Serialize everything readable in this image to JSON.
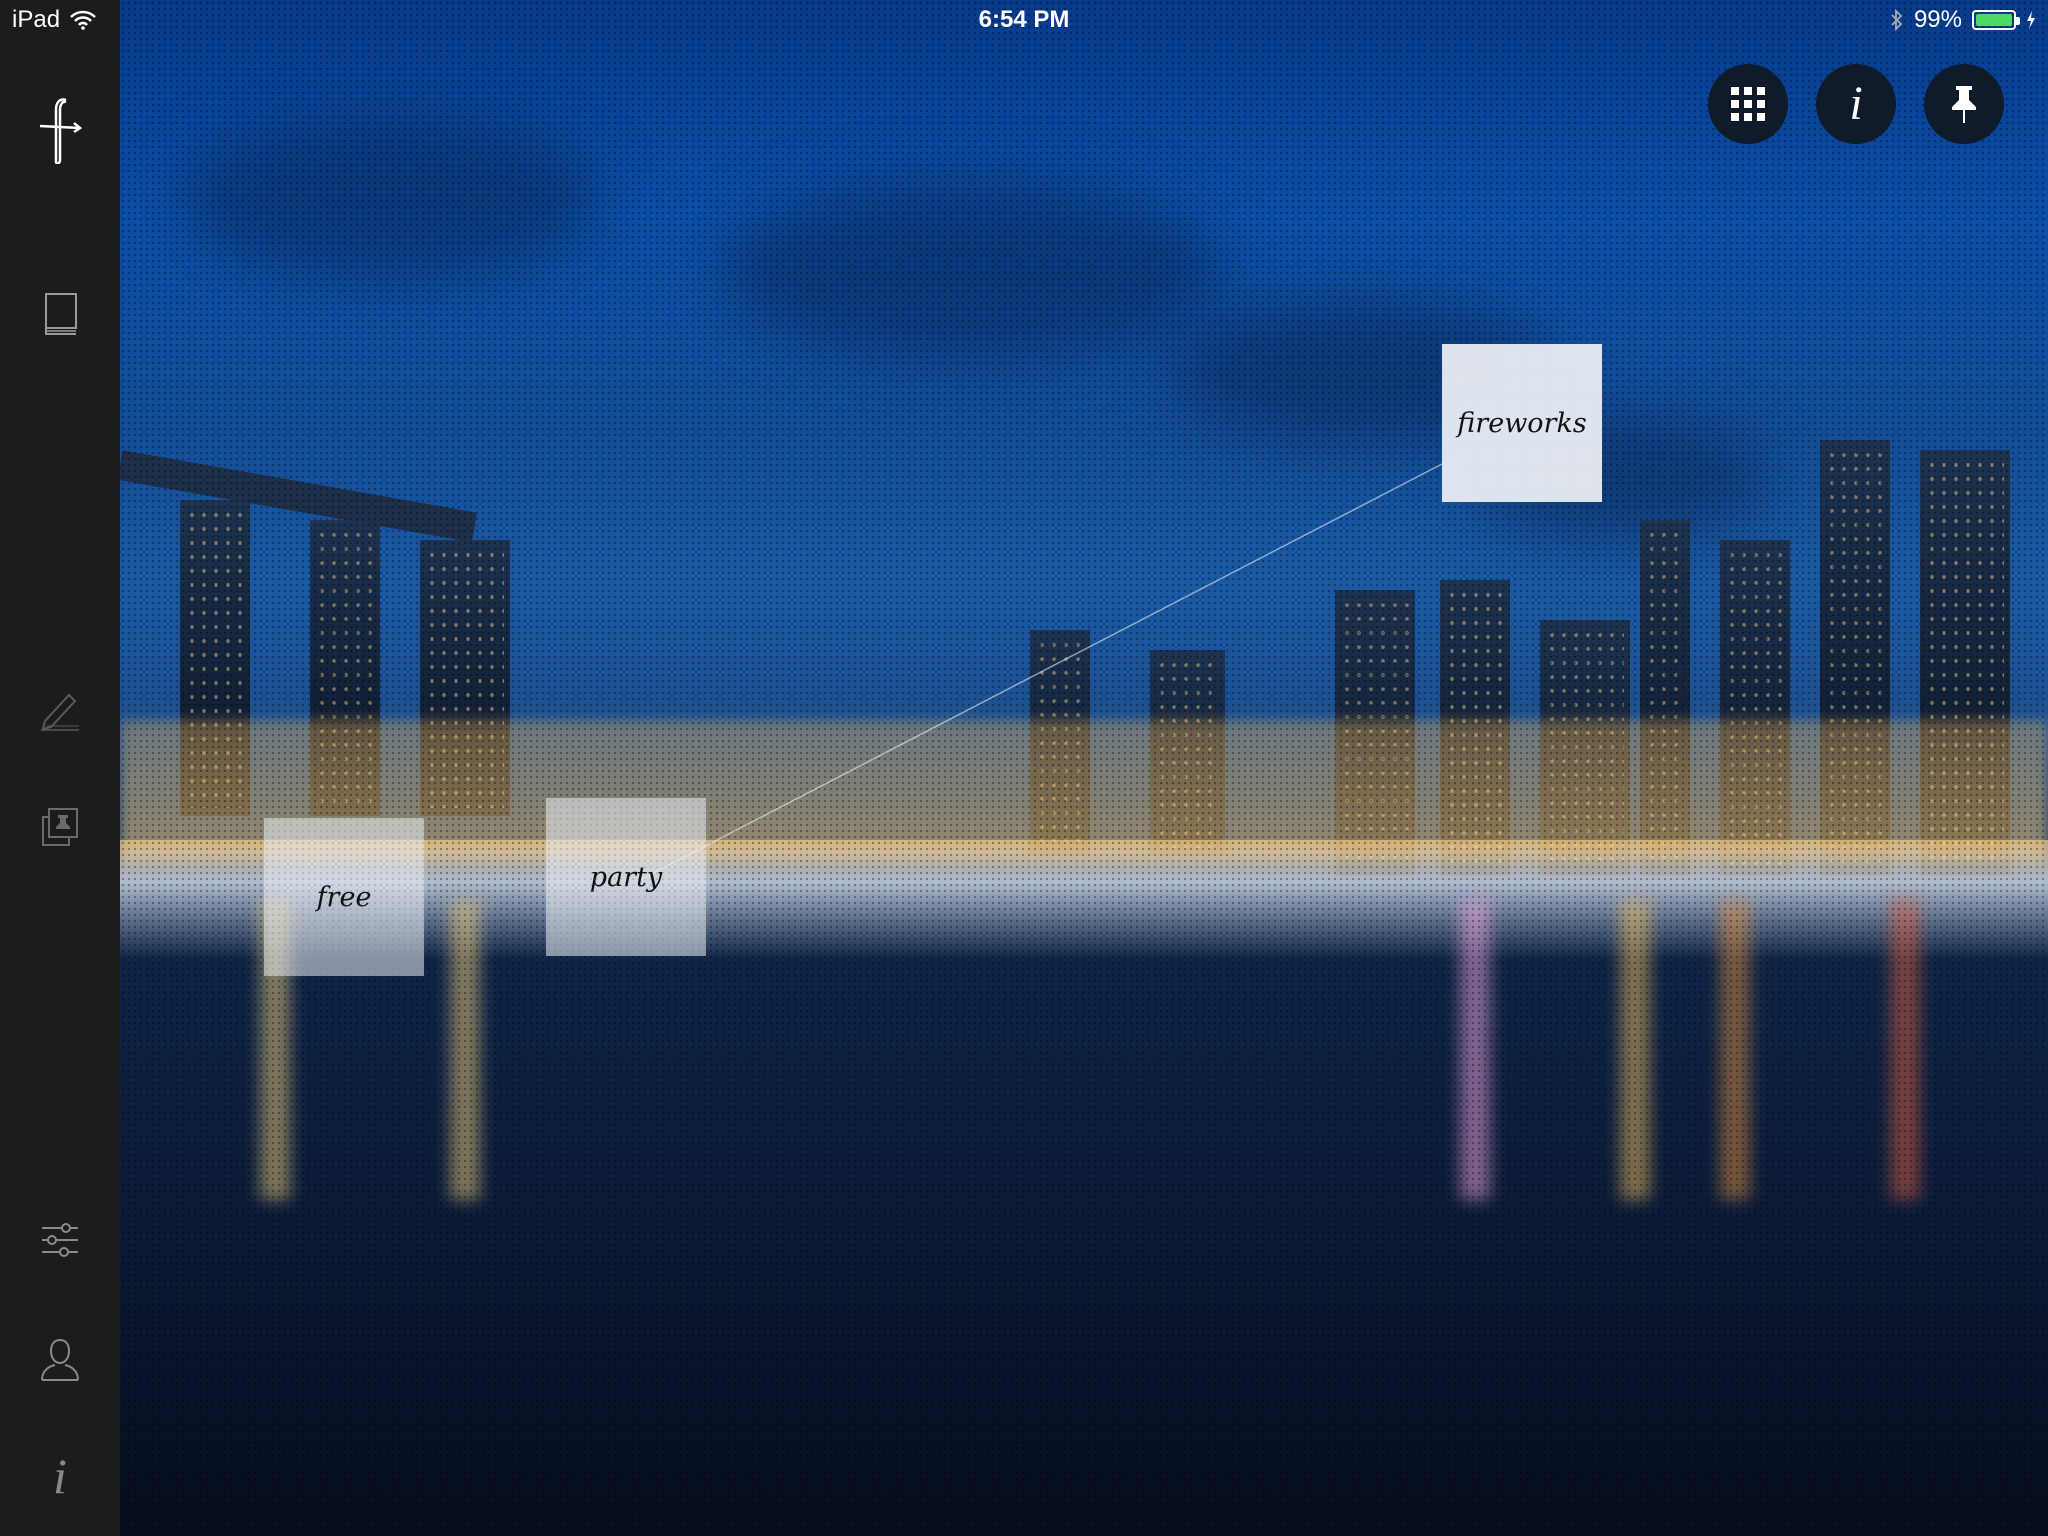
{
  "status_bar": {
    "device": "iPad",
    "time": "6:54 PM",
    "battery_percent": "99%",
    "battery_level": 0.99,
    "battery_color": "#4cd964"
  },
  "sidebar": {
    "items": [
      {
        "name": "app-logo",
        "icon": "flipboard-f-logo"
      },
      {
        "name": "library",
        "icon": "book-icon"
      },
      {
        "name": "edit",
        "icon": "pencil-icon"
      },
      {
        "name": "pinned-collections",
        "icon": "stacked-pins-icon"
      },
      {
        "name": "settings",
        "icon": "sliders-icon"
      },
      {
        "name": "profile",
        "icon": "person-icon"
      },
      {
        "name": "about",
        "icon": "info-icon",
        "label": "i"
      }
    ]
  },
  "toolbar": {
    "grid_button": {
      "icon": "grid-icon"
    },
    "info_button": {
      "icon": "info-icon",
      "label": "i"
    },
    "pin_button": {
      "icon": "pushpin-icon"
    }
  },
  "tags": [
    {
      "label": "fireworks"
    },
    {
      "label": "free"
    },
    {
      "label": "party"
    }
  ],
  "colors": {
    "sidebar_bg": "#1c1c1e",
    "sky_top": "#073a8a",
    "water_bottom": "#060d1e",
    "button_bg": "#0f1a2b"
  }
}
